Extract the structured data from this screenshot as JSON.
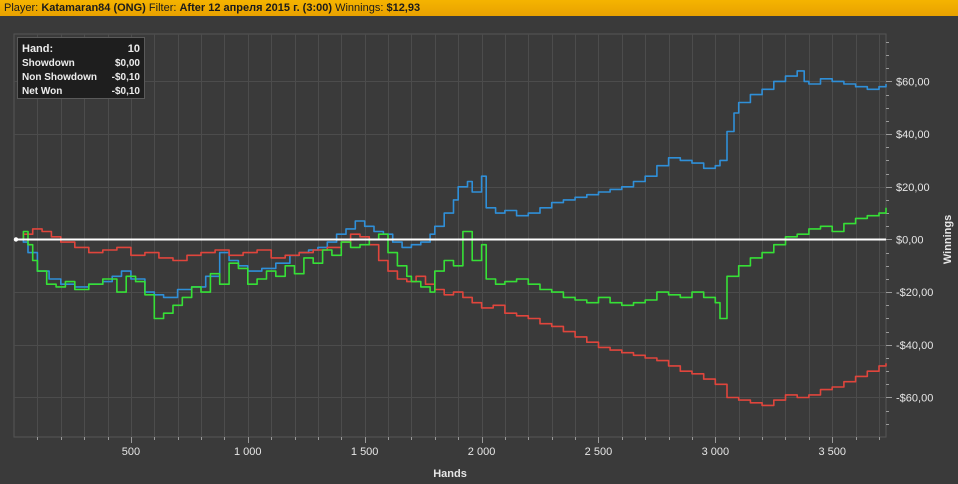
{
  "header": {
    "player_label": "Player:",
    "player_value": "Katamaran84 (ONG)",
    "filter_label": "Filter:",
    "filter_value": "After 12 апреля 2015 г. (3:00)",
    "winnings_label": "Winnings:",
    "winnings_value": "$12,93"
  },
  "stats": {
    "rows": [
      {
        "label": "Hand:",
        "value": "10"
      },
      {
        "label": "Showdown",
        "value": "$0,00"
      },
      {
        "label": "Non Showdown",
        "value": "-$0,10"
      },
      {
        "label": "Net Won",
        "value": "-$0,10"
      }
    ]
  },
  "colors": {
    "background": "#3a3a3a",
    "grid": "#4c4c4c",
    "header": "#f0aa00",
    "zero_line": "#ffffff",
    "text": "#e6e6e6"
  },
  "chart_data": {
    "type": "line",
    "xlabel": "Hands",
    "ylabel": "Winnings",
    "xlim": [
      0,
      3730
    ],
    "ylim": [
      -75,
      78
    ],
    "x_ticks": [
      500,
      1000,
      1500,
      2000,
      2500,
      3000,
      3500
    ],
    "x_tick_labels": [
      "500",
      "1 000",
      "1 500",
      "2 000",
      "2 500",
      "3 000",
      "3 500"
    ],
    "y_ticks": [
      60,
      40,
      20,
      0,
      -20,
      -40,
      -60
    ],
    "y_tick_labels": [
      "$60,00",
      "$40,00",
      "$20,00",
      "$0,00",
      "-$20,00",
      "-$40,00",
      "-$60,00"
    ],
    "grid": true,
    "series": [
      {
        "color": "#2f8fd8",
        "x": [
          0,
          40,
          60,
          100,
          150,
          200,
          260,
          320,
          380,
          420,
          460,
          500,
          560,
          600,
          640,
          700,
          760,
          820,
          880,
          920,
          960,
          1000,
          1060,
          1120,
          1180,
          1220,
          1260,
          1300,
          1340,
          1380,
          1420,
          1460,
          1500,
          1540,
          1580,
          1620,
          1660,
          1700,
          1740,
          1780,
          1800,
          1840,
          1880,
          1900,
          1940,
          1960,
          2000,
          2020,
          2060,
          2100,
          2150,
          2200,
          2250,
          2300,
          2350,
          2400,
          2450,
          2500,
          2550,
          2600,
          2650,
          2700,
          2750,
          2800,
          2850,
          2900,
          2950,
          3000,
          3020,
          3050,
          3080,
          3100,
          3150,
          3200,
          3250,
          3300,
          3350,
          3380,
          3400,
          3450,
          3500,
          3550,
          3600,
          3650,
          3700,
          3730
        ],
        "y": [
          0,
          -1,
          -5,
          -12,
          -15,
          -17,
          -18,
          -17,
          -16,
          -14,
          -12,
          -15,
          -20,
          -21,
          -22,
          -19,
          -18,
          -14,
          -5,
          -8,
          -10,
          -12,
          -11,
          -9,
          -6,
          -5,
          -4,
          -3,
          -1,
          2,
          4,
          7,
          5,
          3,
          2,
          -1,
          -3,
          -2,
          -1,
          2,
          5,
          10,
          15,
          20,
          22,
          18,
          24,
          12,
          10,
          11,
          9,
          10,
          12,
          14,
          15,
          16,
          17,
          18,
          19,
          20,
          22,
          24,
          28,
          31,
          30,
          29,
          27,
          28,
          30,
          41,
          48,
          52,
          55,
          57,
          60,
          62,
          64,
          60,
          59,
          61,
          60,
          59,
          58,
          57,
          58,
          59
        ]
      },
      {
        "color": "#e0453c",
        "x": [
          0,
          40,
          80,
          120,
          160,
          200,
          260,
          320,
          380,
          440,
          500,
          560,
          620,
          680,
          740,
          800,
          860,
          920,
          980,
          1040,
          1100,
          1160,
          1220,
          1280,
          1340,
          1400,
          1440,
          1480,
          1520,
          1560,
          1600,
          1640,
          1680,
          1720,
          1760,
          1800,
          1840,
          1880,
          1920,
          1960,
          2000,
          2050,
          2100,
          2150,
          2200,
          2250,
          2300,
          2350,
          2400,
          2450,
          2500,
          2550,
          2600,
          2650,
          2700,
          2750,
          2800,
          2850,
          2900,
          2950,
          3000,
          3050,
          3100,
          3150,
          3200,
          3250,
          3300,
          3350,
          3400,
          3450,
          3500,
          3550,
          3600,
          3650,
          3700,
          3730
        ],
        "y": [
          0,
          2,
          4,
          3,
          1,
          -1,
          -3,
          -5,
          -4,
          -3,
          -6,
          -5,
          -7,
          -8,
          -6,
          -5,
          -4,
          -6,
          -5,
          -4,
          -7,
          -6,
          -5,
          -4,
          -3,
          -1,
          2,
          1,
          -2,
          -8,
          -12,
          -15,
          -16,
          -14,
          -17,
          -19,
          -21,
          -20,
          -22,
          -24,
          -26,
          -25,
          -28,
          -29,
          -30,
          -32,
          -33,
          -35,
          -37,
          -39,
          -41,
          -42,
          -43,
          -44,
          -45,
          -46,
          -48,
          -50,
          -51,
          -53,
          -55,
          -60,
          -61,
          -62,
          -63,
          -61,
          -59,
          -60,
          -59,
          -57,
          -56,
          -54,
          -52,
          -50,
          -48,
          -47
        ]
      },
      {
        "color": "#36e036",
        "x": [
          0,
          40,
          60,
          80,
          100,
          140,
          180,
          220,
          260,
          320,
          380,
          440,
          480,
          520,
          560,
          600,
          640,
          680,
          720,
          760,
          800,
          840,
          880,
          920,
          960,
          1000,
          1040,
          1080,
          1120,
          1160,
          1200,
          1240,
          1280,
          1320,
          1360,
          1400,
          1440,
          1480,
          1520,
          1560,
          1600,
          1640,
          1680,
          1700,
          1740,
          1780,
          1800,
          1840,
          1880,
          1920,
          1960,
          2000,
          2020,
          2060,
          2100,
          2150,
          2200,
          2250,
          2300,
          2350,
          2400,
          2450,
          2500,
          2550,
          2600,
          2650,
          2700,
          2750,
          2800,
          2850,
          2900,
          2950,
          3000,
          3020,
          3050,
          3100,
          3150,
          3200,
          3250,
          3300,
          3350,
          3400,
          3450,
          3500,
          3550,
          3600,
          3650,
          3700,
          3730
        ],
        "y": [
          0,
          3,
          -2,
          -8,
          -12,
          -17,
          -18,
          -16,
          -19,
          -17,
          -15,
          -20,
          -14,
          -16,
          -21,
          -30,
          -28,
          -25,
          -22,
          -18,
          -20,
          -13,
          -17,
          -9,
          -11,
          -17,
          -15,
          -12,
          -14,
          -10,
          -13,
          -7,
          -9,
          -4,
          -6,
          -1,
          -3,
          -2,
          0,
          2,
          -5,
          -10,
          -14,
          -16,
          -18,
          -20,
          -12,
          -8,
          -10,
          3,
          -8,
          -2,
          -15,
          -17,
          -16,
          -15,
          -17,
          -19,
          -20,
          -22,
          -23,
          -24,
          -22,
          -24,
          -25,
          -24,
          -23,
          -20,
          -21,
          -22,
          -20,
          -22,
          -24,
          -30,
          -14,
          -10,
          -7,
          -5,
          -2,
          1,
          2,
          4,
          5,
          3,
          6,
          8,
          9,
          10,
          12
        ]
      }
    ]
  }
}
